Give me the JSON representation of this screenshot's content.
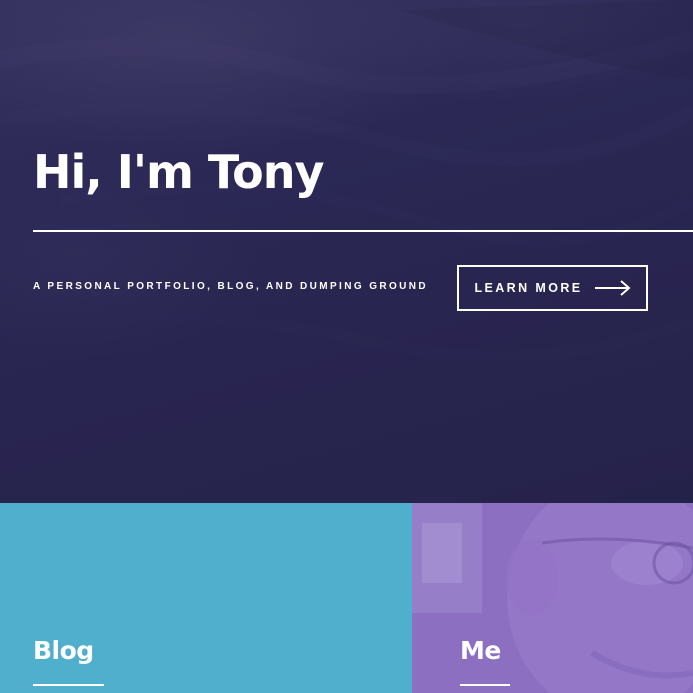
{
  "hero": {
    "title": "Hi, I'm Tony",
    "tagline": "A PERSONAL PORTFOLIO, BLOG, AND DUMPING GROUND",
    "cta_label": "LEARN MORE",
    "cta_icon": "arrow-right-icon",
    "background_color": "#2a2752"
  },
  "tiles": [
    {
      "title": "Blog",
      "color": "#4fafcd"
    },
    {
      "title": "Me",
      "color": "#8c6fc0"
    }
  ]
}
